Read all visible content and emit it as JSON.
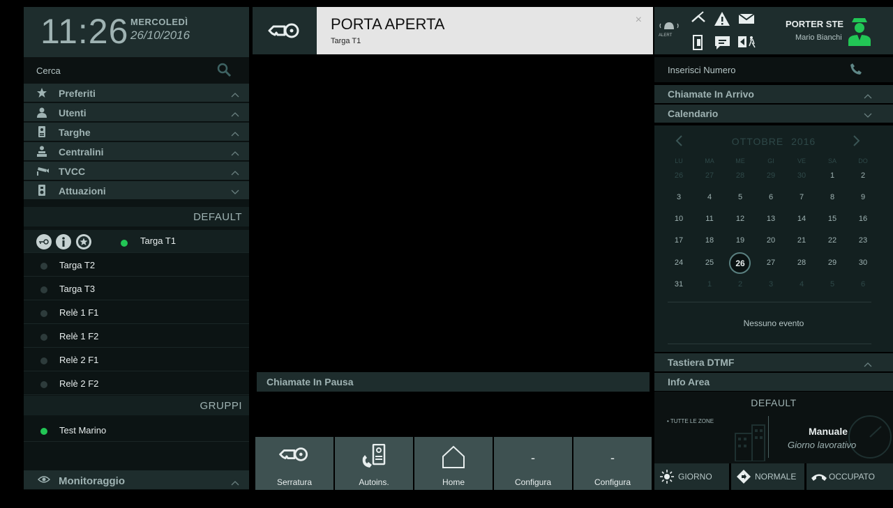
{
  "clock": {
    "time": "11:26",
    "day": "MERCOLEDÌ",
    "date": "26/10/2016"
  },
  "search": {
    "placeholder": "Cerca"
  },
  "sidebar": {
    "sections": [
      {
        "label": "Preferiti",
        "icon": "star-icon"
      },
      {
        "label": "Utenti",
        "icon": "user-icon"
      },
      {
        "label": "Targhe",
        "icon": "door-station-icon"
      },
      {
        "label": "Centralini",
        "icon": "switchboard-icon"
      },
      {
        "label": "TVCC",
        "icon": "cctv-camera-icon"
      },
      {
        "label": "Attuazioni",
        "icon": "actuator-icon"
      }
    ],
    "default_header": "DEFAULT",
    "actuations": [
      {
        "label": "Targa T1",
        "active": true
      },
      {
        "label": "Targa T2",
        "active": false
      },
      {
        "label": "Targa T3",
        "active": false
      },
      {
        "label": "Relè 1 F1",
        "active": false
      },
      {
        "label": "Relè 1 F2",
        "active": false
      },
      {
        "label": "Relè 2 F1",
        "active": false
      },
      {
        "label": "Relè 2 F2",
        "active": false
      }
    ],
    "groups_header": "GRUPPI",
    "groups": [
      {
        "label": "Test Marino",
        "active": true
      }
    ],
    "monitor": {
      "label": "Monitoraggio",
      "icon": "eye-icon"
    }
  },
  "banner": {
    "title": "PORTA APERTA",
    "subtitle": "Targa T1",
    "close": "×"
  },
  "center": {
    "paused_header": "Chiamate In Pausa"
  },
  "toolbar": [
    {
      "label": "Serratura",
      "icon": "key-icon"
    },
    {
      "label": "Autoins.",
      "icon": "self-insert-icon"
    },
    {
      "label": "Home",
      "icon": "home-icon"
    },
    {
      "label": "Configura",
      "icon": "dash",
      "glyph": "-"
    },
    {
      "label": "Configura",
      "icon": "dash",
      "glyph": "-"
    }
  ],
  "topright": {
    "alert_label": "ALERT",
    "porter_name": "PORTER STE",
    "user_name": "Mario Bianchi"
  },
  "right": {
    "number_placeholder": "Inserisci Numero",
    "incoming": "Chiamate In Arrivo",
    "calendar": "Calendario",
    "dtmf": "Tastiera DTMF",
    "info_area": "Info Area"
  },
  "calendar": {
    "month": "OTTOBRE",
    "year": "2016",
    "weekdays": [
      "LU",
      "MA",
      "ME",
      "GI",
      "VE",
      "SA",
      "DO"
    ],
    "weeks": [
      [
        "26",
        "27",
        "28",
        "29",
        "30",
        "1",
        "2"
      ],
      [
        "3",
        "4",
        "5",
        "6",
        "7",
        "8",
        "9"
      ],
      [
        "10",
        "11",
        "12",
        "13",
        "14",
        "15",
        "16"
      ],
      [
        "17",
        "18",
        "19",
        "20",
        "21",
        "22",
        "23"
      ],
      [
        "24",
        "25",
        "26",
        "27",
        "28",
        "29",
        "30"
      ],
      [
        "31",
        "1",
        "2",
        "3",
        "4",
        "5",
        "6"
      ]
    ],
    "today": "26",
    "no_events": "Nessuno evento"
  },
  "info": {
    "profile": "DEFAULT",
    "zones": "• TUTTE LE ZONE",
    "mode": "Manuale",
    "day_type": "Giorno lavorativo"
  },
  "modes": [
    {
      "label": "GIORNO",
      "icon": "sun-icon"
    },
    {
      "label": "NORMALE",
      "icon": "diamond-arrow-icon"
    },
    {
      "label": "OCCUPATO",
      "icon": "handset-icon"
    }
  ],
  "colors": {
    "panel": "#1e2d2d",
    "accent_green": "#22c655",
    "button": "#3e5151"
  }
}
